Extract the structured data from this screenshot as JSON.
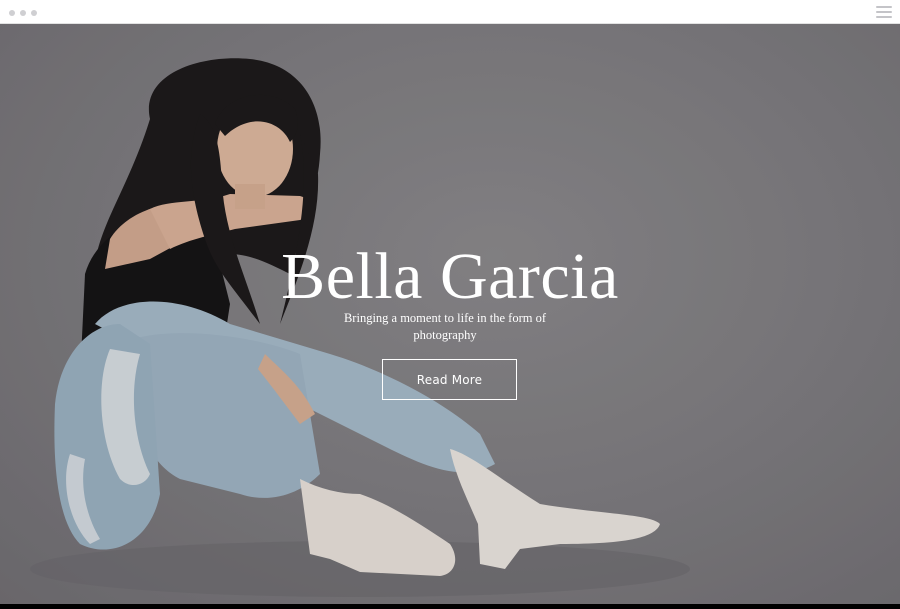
{
  "window": {
    "controls": [
      "dot",
      "dot",
      "dot"
    ],
    "menu_icon": "hamburger-menu-icon"
  },
  "hero": {
    "title": "Bella Garcia",
    "subtitle": "Bringing a moment to life in the form of photography",
    "cta_label": "Read More"
  },
  "colors": {
    "background_gray": "#827f84",
    "text": "#ffffff",
    "bar": "#ffffff",
    "dots": "#cfcfd2"
  }
}
